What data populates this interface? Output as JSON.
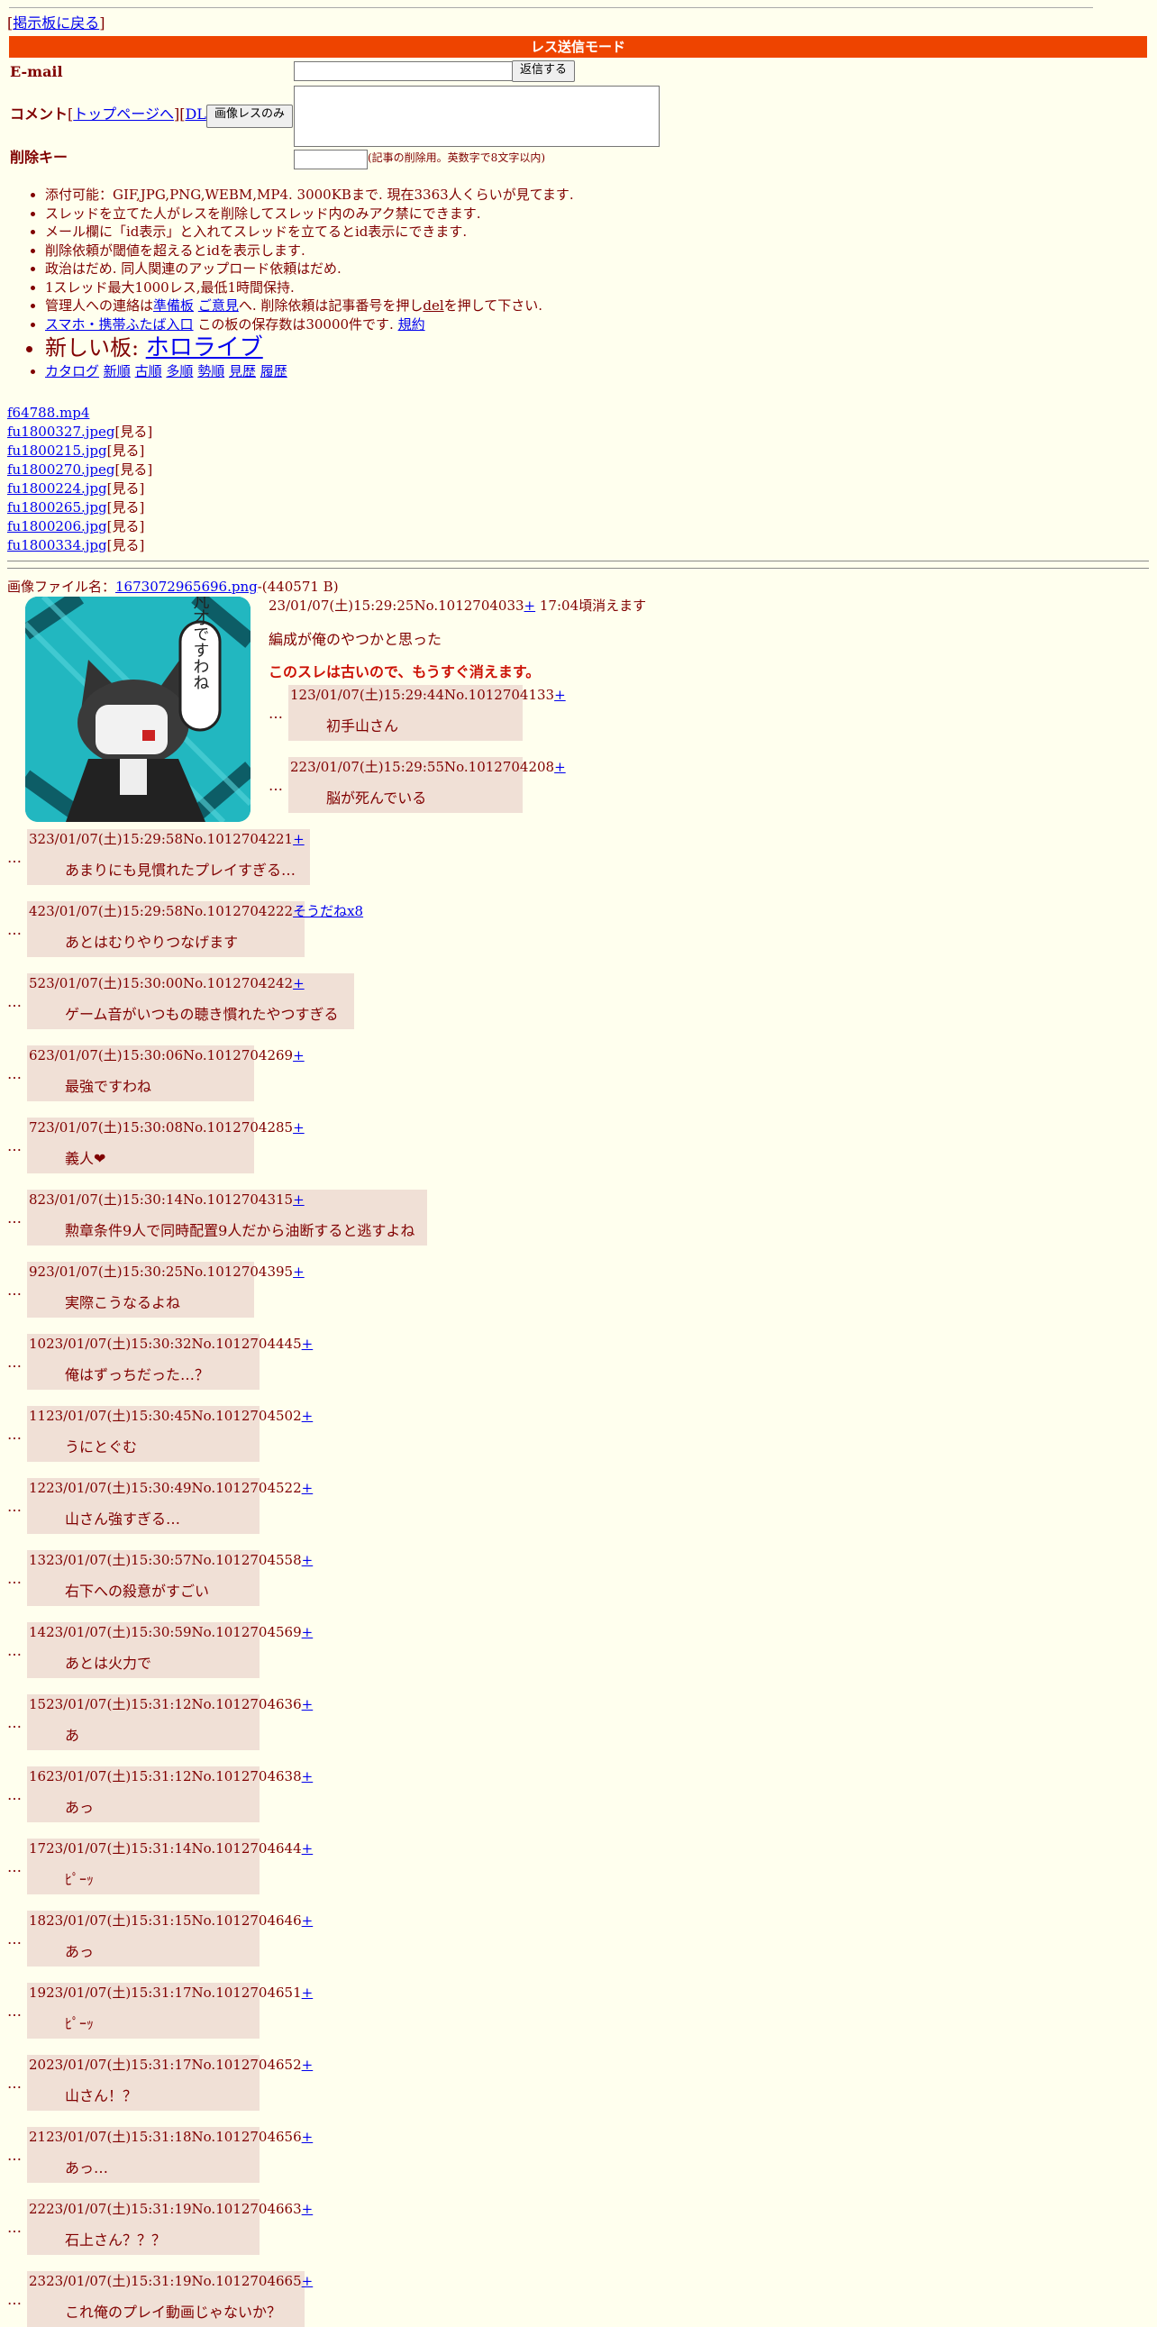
{
  "nav": {
    "back_label": "[掲示板に戻る]",
    "back_link": "掲示板に戻る"
  },
  "mode_bar": "レス送信モード",
  "form": {
    "email_label": "E-mail",
    "submit_label": "返信する",
    "comment_label": "コメント",
    "top_link": "トップページへ",
    "dl_link": "DL",
    "image_only_label": "画像レスのみ",
    "delkey_label": "削除キー",
    "delkey_note": "(記事の削除用。英数字で8文字以内)"
  },
  "rules": [
    "添付可能：GIF,JPG,PNG,WEBM,MP4. 3000KBまで. 現在3363人くらいが見てます.",
    "スレッドを立てた人がレスを削除してスレッド内のみアク禁にできます.",
    "メール欄に「id表示」と入れてスレッドを立てるとid表示にできます.",
    "削除依頼が閾値を超えるとidを表示します.",
    "政治はだめ. 同人関連のアップロード依頼はだめ.",
    "1スレッド最大1000レス,最低1時間保持."
  ],
  "contact": {
    "pre": "管理人への連絡は",
    "link1": "準備板",
    "link2": "ご意見",
    "post": "へ. 削除依頼は記事番号を押し",
    "del": "del",
    "post2": "を押して下さい."
  },
  "mobile": {
    "link": "スマホ・携帯ふたば入口",
    "text": " この板の保存数は30000件です. ",
    "terms": "規約"
  },
  "new_board": {
    "label": "新しい板: ",
    "link": "ホロライブ"
  },
  "sort_links": [
    "カタログ",
    "新順",
    "古順",
    "多順",
    "勢順",
    "見歴",
    "履歴"
  ],
  "files": [
    {
      "name": "f64788.mp4",
      "suffix": ""
    },
    {
      "name": "fu1800327.jpeg",
      "suffix": "[見る]"
    },
    {
      "name": "fu1800215.jpg",
      "suffix": "[見る]"
    },
    {
      "name": "fu1800270.jpeg",
      "suffix": "[見る]"
    },
    {
      "name": "fu1800224.jpg",
      "suffix": "[見る]"
    },
    {
      "name": "fu1800265.jpg",
      "suffix": "[見る]"
    },
    {
      "name": "fu1800206.jpg",
      "suffix": "[見る]"
    },
    {
      "name": "fu1800334.jpg",
      "suffix": "[見る]"
    }
  ],
  "op": {
    "image_label": "画像ファイル名：",
    "image_name": "1673072965696.png",
    "image_size": "-(440571 B)",
    "head": "23/01/07(土)15:29:25No.1012704033",
    "plus": "+",
    "expire": " 17:04頃消えます",
    "body": "編成が俺のやつかと思った",
    "warning": "このスレは古いので、もうすぐ消えます。",
    "thumb_text": "凡才ですわね"
  },
  "replies": [
    {
      "num": "1",
      "head": "23/01/07(土)15:29:44No.1012704133",
      "plus": "+",
      "msg": "初手山さん"
    },
    {
      "num": "2",
      "head": "23/01/07(土)15:29:55No.1012704208",
      "plus": "+",
      "msg": "脳が死んでいる"
    },
    {
      "num": "3",
      "head": "23/01/07(土)15:29:58No.1012704221",
      "plus": "+",
      "msg": "あまりにも見慣れたプレイすぎる…"
    },
    {
      "num": "4",
      "head": "23/01/07(土)15:29:58No.1012704222",
      "plus": "そうだねx8",
      "msg": "あとはむりやりつなげます"
    },
    {
      "num": "5",
      "head": "23/01/07(土)15:30:00No.1012704242",
      "plus": "+",
      "msg": "ゲーム音がいつもの聴き慣れたやつすぎる"
    },
    {
      "num": "6",
      "head": "23/01/07(土)15:30:06No.1012704269",
      "plus": "+",
      "msg": "最強ですわね"
    },
    {
      "num": "7",
      "head": "23/01/07(土)15:30:08No.1012704285",
      "plus": "+",
      "msg": "義人❤"
    },
    {
      "num": "8",
      "head": "23/01/07(土)15:30:14No.1012704315",
      "plus": "+",
      "msg": "勲章条件9人で同時配置9人だから油断すると逃すよね"
    },
    {
      "num": "9",
      "head": "23/01/07(土)15:30:25No.1012704395",
      "plus": "+",
      "msg": "実際こうなるよね"
    },
    {
      "num": "10",
      "head": "23/01/07(土)15:30:32No.1012704445",
      "plus": "+",
      "msg": "俺はずっちだった…？"
    },
    {
      "num": "11",
      "head": "23/01/07(土)15:30:45No.1012704502",
      "plus": "+",
      "msg": "うにとぐむ"
    },
    {
      "num": "12",
      "head": "23/01/07(土)15:30:49No.1012704522",
      "plus": "+",
      "msg": "山さん強すぎる…"
    },
    {
      "num": "13",
      "head": "23/01/07(土)15:30:57No.1012704558",
      "plus": "+",
      "msg": "右下への殺意がすごい"
    },
    {
      "num": "14",
      "head": "23/01/07(土)15:30:59No.1012704569",
      "plus": "+",
      "msg": "あとは火力で"
    },
    {
      "num": "15",
      "head": "23/01/07(土)15:31:12No.1012704636",
      "plus": "+",
      "msg": "あ"
    },
    {
      "num": "16",
      "head": "23/01/07(土)15:31:12No.1012704638",
      "plus": "+",
      "msg": "あっ"
    },
    {
      "num": "17",
      "head": "23/01/07(土)15:31:14No.1012704644",
      "plus": "+",
      "msg": "ﾋﾟｰｯ"
    },
    {
      "num": "18",
      "head": "23/01/07(土)15:31:15No.1012704646",
      "plus": "+",
      "msg": "あっ"
    },
    {
      "num": "19",
      "head": "23/01/07(土)15:31:17No.1012704651",
      "plus": "+",
      "msg": "ﾋﾟｰｯ"
    },
    {
      "num": "20",
      "head": "23/01/07(土)15:31:17No.1012704652",
      "plus": "+",
      "msg": "山さん！？"
    },
    {
      "num": "21",
      "head": "23/01/07(土)15:31:18No.1012704656",
      "plus": "+",
      "msg": "あっ…"
    },
    {
      "num": "22",
      "head": "23/01/07(土)15:31:19No.1012704663",
      "plus": "+",
      "msg": "石上さん？？？"
    },
    {
      "num": "23",
      "head": "23/01/07(土)15:31:19No.1012704665",
      "plus": "+",
      "msg": "これ俺のプレイ動画じゃないか？"
    }
  ],
  "colors": {
    "background": "#ffffee",
    "text": "#800000",
    "reply_bg": "#f0e0d6",
    "mode_bar": "#ee4400",
    "warning": "#cc1105",
    "link": "#0000ee"
  }
}
